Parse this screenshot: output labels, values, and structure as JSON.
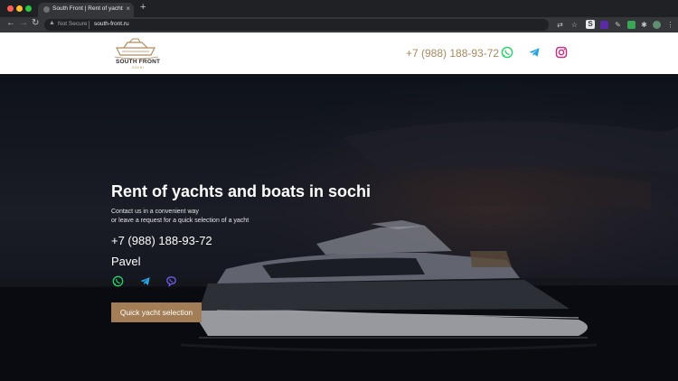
{
  "browser": {
    "tab_title": "South Front | Rent of yachts an",
    "tab_close": "×",
    "new_tab": "+",
    "security_label": "Not Secure",
    "url": "south-front.ru",
    "ext_s_label": "S"
  },
  "header": {
    "logo_text": "SOUTH FRONT",
    "logo_subtext": "SOCHI",
    "phone": "+7 (988) 188-93-72",
    "social_icons": [
      "whatsapp-icon",
      "telegram-icon",
      "instagram-icon"
    ]
  },
  "hero": {
    "title": "Rent of yachts and boats in sochi",
    "line1": "Contact us in a convenient way",
    "line2": "or leave a request for a quick selection of a yacht",
    "phone": "+7 (988) 188-93-72",
    "name": "Pavel",
    "messenger_icons": [
      "whatsapp-icon",
      "telegram-icon",
      "viber-icon"
    ],
    "cta_label": "Quick yacht selection"
  },
  "colors": {
    "accent_gold": "#a8895f",
    "cta_background": "#a37d55",
    "whatsapp": "#25d366",
    "telegram": "#2aa3e0",
    "instagram": "#c13584",
    "viber": "#7360f2"
  }
}
